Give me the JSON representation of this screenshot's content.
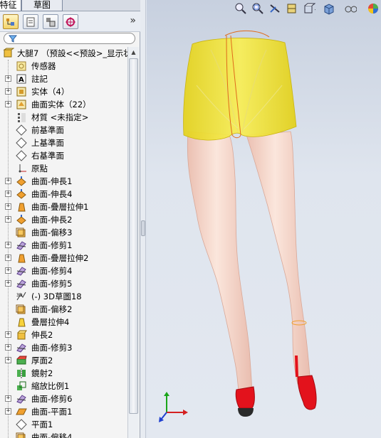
{
  "tabs": [
    {
      "label": "特征"
    },
    {
      "label": "草图"
    }
  ],
  "feature_manager": {
    "toolbar_icons": [
      "feature-tree-icon",
      "property-manager-icon",
      "configuration-manager-icon",
      "display-manager-icon"
    ],
    "expand_glyph": "»",
    "filter_icon": "funnel-icon"
  },
  "tree": {
    "root": {
      "label": "大腿7 （预設<<预設>_显示状",
      "icon": "part-icon"
    },
    "items": [
      {
        "label": "传感器",
        "icon": "sensor-icon",
        "expandable": false
      },
      {
        "label": "註記",
        "icon": "annotation-icon",
        "expandable": true
      },
      {
        "label": "实体（4）",
        "icon": "solid-bodies-icon",
        "expandable": true
      },
      {
        "label": "曲面实体（22）",
        "icon": "surface-bodies-icon",
        "expandable": true
      },
      {
        "label": "材質 <未指定>",
        "icon": "material-icon",
        "expandable": false
      },
      {
        "label": "前基準面",
        "icon": "plane-icon",
        "expandable": false
      },
      {
        "label": "上基準面",
        "icon": "plane-icon",
        "expandable": false
      },
      {
        "label": "右基準面",
        "icon": "plane-icon",
        "expandable": false
      },
      {
        "label": "原點",
        "icon": "origin-icon",
        "expandable": false
      },
      {
        "label": "曲面-伸長1",
        "icon": "surface-extrude-icon",
        "expandable": true
      },
      {
        "label": "曲面-伸長4",
        "icon": "surface-extrude-icon",
        "expandable": true
      },
      {
        "label": "曲面-疊層拉伸1",
        "icon": "surface-loft-icon",
        "expandable": true
      },
      {
        "label": "曲面-伸長2",
        "icon": "surface-extrude-icon",
        "expandable": true
      },
      {
        "label": "曲面-偏移3",
        "icon": "surface-offset-icon",
        "expandable": false
      },
      {
        "label": "曲面-修剪1",
        "icon": "surface-trim-icon",
        "expandable": true
      },
      {
        "label": "曲面-疊層拉伸2",
        "icon": "surface-loft-icon",
        "expandable": true
      },
      {
        "label": "曲面-修剪4",
        "icon": "surface-trim-icon",
        "expandable": true
      },
      {
        "label": "曲面-修剪5",
        "icon": "surface-trim-icon",
        "expandable": true
      },
      {
        "label": "(-) 3D草圖18",
        "icon": "3d-sketch-icon",
        "expandable": false
      },
      {
        "label": "曲面-偏移2",
        "icon": "surface-offset-icon",
        "expandable": false
      },
      {
        "label": "疊層拉伸4",
        "icon": "loft-icon",
        "expandable": false
      },
      {
        "label": "伸長2",
        "icon": "extrude-icon",
        "expandable": true
      },
      {
        "label": "曲面-修剪3",
        "icon": "surface-trim-icon",
        "expandable": true
      },
      {
        "label": "厚面2",
        "icon": "thicken-icon",
        "expandable": true
      },
      {
        "label": "鏡射2",
        "icon": "mirror-icon",
        "expandable": false
      },
      {
        "label": "縮放比例1",
        "icon": "scale-icon",
        "expandable": false
      },
      {
        "label": "曲面-修剪6",
        "icon": "surface-trim-icon",
        "expandable": true
      },
      {
        "label": "曲面-平面1",
        "icon": "planar-surface-icon",
        "expandable": true
      },
      {
        "label": "平面1",
        "icon": "plane-icon",
        "expandable": false
      },
      {
        "label": "曲面-偏移4",
        "icon": "surface-offset-icon",
        "expandable": false
      }
    ]
  },
  "viewport": {
    "toolbar_icons": [
      "zoom-to-fit-icon",
      "zoom-to-area-icon",
      "previous-view-icon",
      "section-view-icon",
      "view-orientation-icon",
      "display-style-icon",
      "hide-show-items-icon",
      "appearance-icon"
    ],
    "colors": {
      "shorts": "#f2e330",
      "legs": "#f6d6c8",
      "shoes": "#e3121c",
      "heel": "#2a2a2a"
    },
    "triad_icon": "coordinate-triad-icon"
  }
}
